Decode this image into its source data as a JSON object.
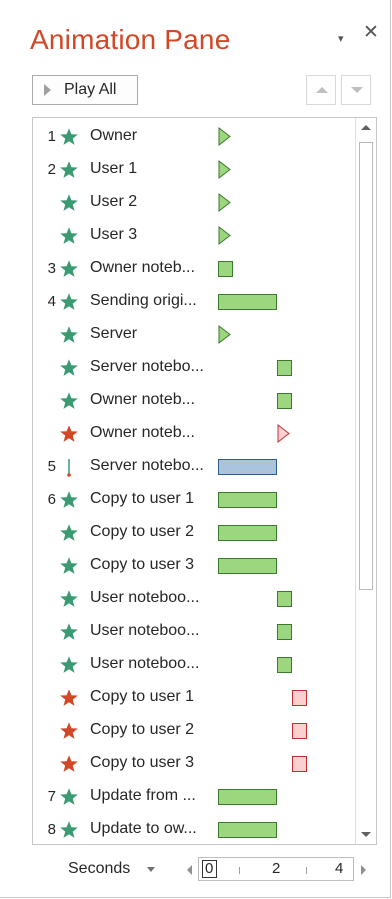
{
  "pane": {
    "title": "Animation Pane",
    "menu_icon": "▾",
    "close_icon": "✕"
  },
  "toolbar": {
    "play_all_label": "Play All",
    "play_icon": "play-triangle",
    "move_up_icon": "up-arrow",
    "move_down_icon": "down-arrow"
  },
  "colors": {
    "title": "#d24726",
    "entrance_star": "#3a9a72",
    "exit_star": "#d24726",
    "motion_path": "#3a9a72",
    "green_bar": "#9cd67f",
    "blue_bar": "#a9c4dc",
    "pink_bar": "#fbd0d0"
  },
  "animations": [
    {
      "num": "1",
      "icon": "green-star",
      "label": "Owner",
      "bar": {
        "kind": "tri-green",
        "start": 0,
        "dur": 0
      }
    },
    {
      "num": "2",
      "icon": "green-star",
      "label": "User 1",
      "bar": {
        "kind": "tri-green",
        "start": 0,
        "dur": 0
      }
    },
    {
      "num": "",
      "icon": "green-star",
      "label": "User 2",
      "bar": {
        "kind": "tri-green",
        "start": 0,
        "dur": 0
      }
    },
    {
      "num": "",
      "icon": "green-star",
      "label": "User 3",
      "bar": {
        "kind": "tri-green",
        "start": 0,
        "dur": 0
      }
    },
    {
      "num": "3",
      "icon": "green-star",
      "label": "Owner noteb...",
      "bar": {
        "kind": "green",
        "start": 0,
        "dur": 0.25
      }
    },
    {
      "num": "4",
      "icon": "green-star",
      "label": "Sending origi...",
      "bar": {
        "kind": "green",
        "start": 0,
        "dur": 1
      }
    },
    {
      "num": "",
      "icon": "green-star",
      "label": "Server",
      "bar": {
        "kind": "tri-green",
        "start": 0,
        "dur": 0
      }
    },
    {
      "num": "",
      "icon": "green-star",
      "label": "Server notebo...",
      "bar": {
        "kind": "green",
        "start": 1,
        "dur": 0.25
      }
    },
    {
      "num": "",
      "icon": "green-star",
      "label": "Owner noteb...",
      "bar": {
        "kind": "green",
        "start": 1,
        "dur": 0.25
      }
    },
    {
      "num": "",
      "icon": "red-star",
      "label": "Owner noteb...",
      "bar": {
        "kind": "tri-pink",
        "start": 1,
        "dur": 0
      }
    },
    {
      "num": "5",
      "icon": "motion-path",
      "label": "Server notebo...",
      "bar": {
        "kind": "blue",
        "start": 0,
        "dur": 1
      }
    },
    {
      "num": "6",
      "icon": "green-star",
      "label": "Copy to user 1",
      "bar": {
        "kind": "green",
        "start": 0,
        "dur": 1
      }
    },
    {
      "num": "",
      "icon": "green-star",
      "label": "Copy to user 2",
      "bar": {
        "kind": "green",
        "start": 0,
        "dur": 1
      }
    },
    {
      "num": "",
      "icon": "green-star",
      "label": "Copy to user 3",
      "bar": {
        "kind": "green",
        "start": 0,
        "dur": 1
      }
    },
    {
      "num": "",
      "icon": "green-star",
      "label": "User noteboo...",
      "bar": {
        "kind": "green",
        "start": 1,
        "dur": 0.25
      }
    },
    {
      "num": "",
      "icon": "green-star",
      "label": "User noteboo...",
      "bar": {
        "kind": "green",
        "start": 1,
        "dur": 0.25
      }
    },
    {
      "num": "",
      "icon": "green-star",
      "label": "User noteboo...",
      "bar": {
        "kind": "green",
        "start": 1,
        "dur": 0.25
      }
    },
    {
      "num": "",
      "icon": "red-star",
      "label": "Copy to user 1",
      "bar": {
        "kind": "pink",
        "start": 1.25,
        "dur": 0.25
      }
    },
    {
      "num": "",
      "icon": "red-star",
      "label": "Copy to user 2",
      "bar": {
        "kind": "pink",
        "start": 1.25,
        "dur": 0.25
      }
    },
    {
      "num": "",
      "icon": "red-star",
      "label": "Copy to user 3",
      "bar": {
        "kind": "pink",
        "start": 1.25,
        "dur": 0.25
      }
    },
    {
      "num": "7",
      "icon": "green-star",
      "label": "Update from ...",
      "bar": {
        "kind": "green",
        "start": 0,
        "dur": 1
      }
    },
    {
      "num": "8",
      "icon": "green-star",
      "label": "Update to ow...",
      "bar": {
        "kind": "green",
        "start": 0,
        "dur": 1
      }
    }
  ],
  "footer": {
    "units_label": "Seconds",
    "ruler_labels": [
      "0",
      "2",
      "4"
    ],
    "scroll_left_icon": "left-arrow",
    "scroll_right_icon": "right-arrow"
  }
}
